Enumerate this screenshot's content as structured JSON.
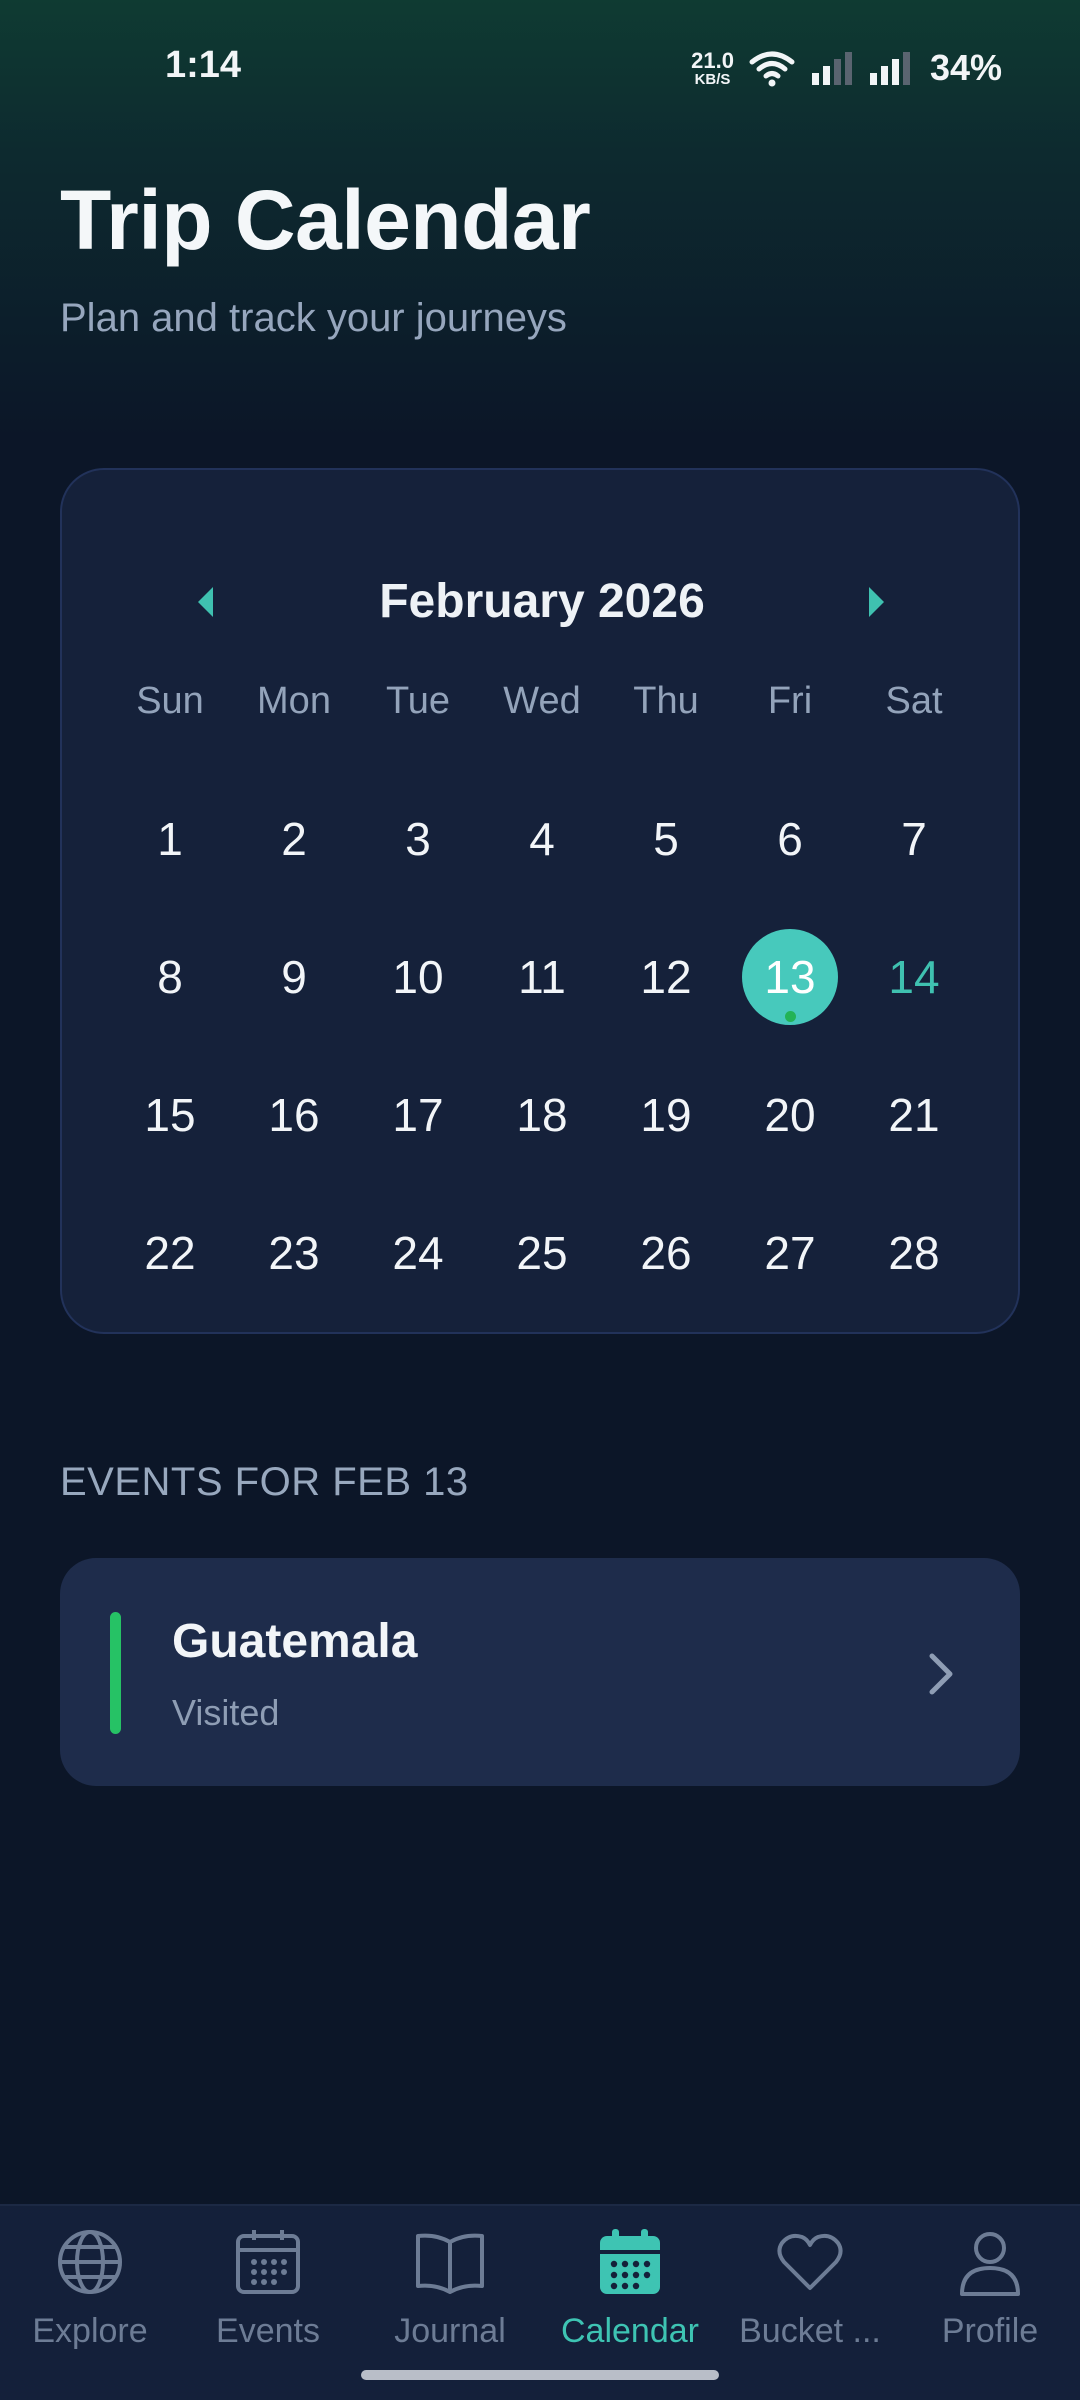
{
  "status_bar": {
    "time": "1:14",
    "net_speed_value": "21.0",
    "net_speed_unit": "KB/S",
    "battery": "34%"
  },
  "header": {
    "title": "Trip Calendar",
    "subtitle": "Plan and track your journeys"
  },
  "calendar": {
    "month_label": "February 2026",
    "weekdays": [
      "Sun",
      "Mon",
      "Tue",
      "Wed",
      "Thu",
      "Fri",
      "Sat"
    ],
    "weeks": [
      [
        "1",
        "2",
        "3",
        "4",
        "5",
        "6",
        "7"
      ],
      [
        "8",
        "9",
        "10",
        "11",
        "12",
        "13",
        "14"
      ],
      [
        "15",
        "16",
        "17",
        "18",
        "19",
        "20",
        "21"
      ],
      [
        "22",
        "23",
        "24",
        "25",
        "26",
        "27",
        "28"
      ]
    ],
    "selected_day": "13",
    "today_day": "14",
    "days_with_events": [
      "13"
    ],
    "colors": {
      "accent": "#47c9bc",
      "today_text": "#3fc1b0",
      "event_dot": "#23b356"
    }
  },
  "events": {
    "heading": "EVENTS FOR FEB 13",
    "items": [
      {
        "title": "Guatemala",
        "status": "Visited",
        "bar_color": "#26c265"
      }
    ]
  },
  "bottom_nav": {
    "items": [
      {
        "label": "Explore",
        "icon": "globe-icon",
        "active": false
      },
      {
        "label": "Events",
        "icon": "calendar-grid-icon",
        "active": false
      },
      {
        "label": "Journal",
        "icon": "book-open-icon",
        "active": false
      },
      {
        "label": "Calendar",
        "icon": "calendar-filled-icon",
        "active": true
      },
      {
        "label": "Bucket ...",
        "icon": "heart-icon",
        "active": false
      },
      {
        "label": "Profile",
        "icon": "person-icon",
        "active": false
      }
    ],
    "colors": {
      "active": "#3ec4b3",
      "inactive": "#6d7c95"
    }
  }
}
